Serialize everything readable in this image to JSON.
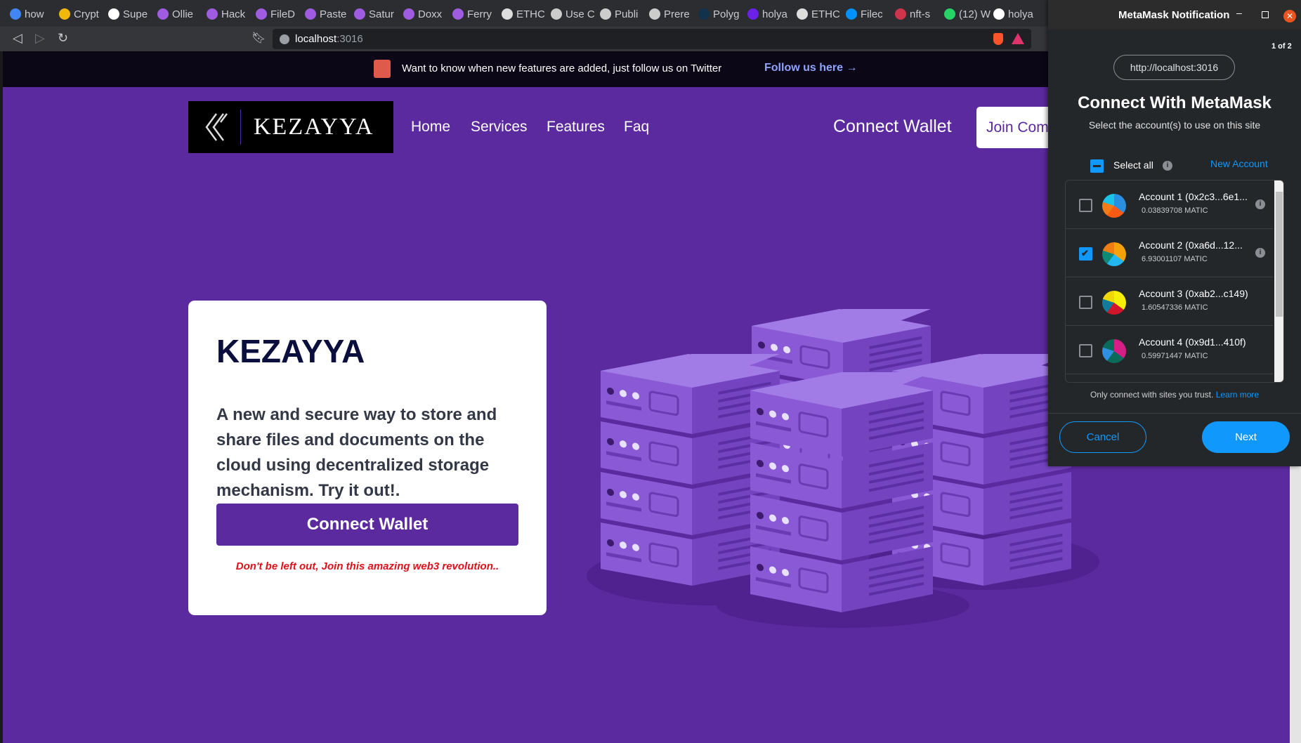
{
  "browser": {
    "tabs": [
      {
        "label": "how",
        "icon": "google-icon",
        "color": "#4285f4"
      },
      {
        "label": "Crypt",
        "icon": "binance-icon",
        "color": "#f0b90b"
      },
      {
        "label": "Supe",
        "icon": "github-icon",
        "color": "#ffffff"
      },
      {
        "label": "Ollie",
        "icon": "graphql-icon",
        "color": "#a05ce0"
      },
      {
        "label": "Hack",
        "icon": "graphql-icon",
        "color": "#a05ce0"
      },
      {
        "label": "FileD",
        "icon": "graphql-icon",
        "color": "#a05ce0"
      },
      {
        "label": "Paste",
        "icon": "graphql-icon",
        "color": "#a05ce0"
      },
      {
        "label": "Satur",
        "icon": "graphql-icon",
        "color": "#a05ce0"
      },
      {
        "label": "Doxx",
        "icon": "graphql-icon",
        "color": "#a05ce0"
      },
      {
        "label": "Ferry",
        "icon": "graphql-icon",
        "color": "#a05ce0"
      },
      {
        "label": "ETHC",
        "icon": "ethc-icon",
        "color": "#dddddd"
      },
      {
        "label": "Use C",
        "icon": "cloud-icon",
        "color": "#cccccc"
      },
      {
        "label": "Publi",
        "icon": "cloud-icon",
        "color": "#cccccc"
      },
      {
        "label": "Prere",
        "icon": "cloud-icon",
        "color": "#cccccc"
      },
      {
        "label": "Polyg",
        "icon": "d-icon",
        "color": "#12314a"
      },
      {
        "label": "holya",
        "icon": "purple-icon",
        "color": "#6b21e8"
      },
      {
        "label": "ETHC",
        "icon": "ethc-icon",
        "color": "#dddddd"
      },
      {
        "label": "Filec",
        "icon": "filecoin-icon",
        "color": "#0090ff"
      },
      {
        "label": "nft-s",
        "icon": "badge-72-icon",
        "color": "#d0344a"
      },
      {
        "label": "(12) W",
        "icon": "whatsapp-icon",
        "color": "#25d366"
      },
      {
        "label": "holya",
        "icon": "github-icon",
        "color": "#ffffff"
      }
    ],
    "url_host": "localhost",
    "url_port": ":3016"
  },
  "banner": {
    "text": "Want to know when new features are added, just follow us on Twitter",
    "link": "Follow us here →"
  },
  "nav": {
    "logo_text": "KEZAYYA",
    "links": [
      "Home",
      "Services",
      "Features",
      "Faq"
    ],
    "connect": "Connect Wallet",
    "join": "Join Com"
  },
  "hero": {
    "title": "KEZAYYA",
    "description": "A new and secure way to store and share files and documents on the cloud using decentralized storage mechanism. Try it out!.",
    "button": "Connect Wallet",
    "tagline": "Don't be left out, Join this amazing web3 revolution.."
  },
  "metamask": {
    "window_title": "MetaMask Notification",
    "page": "1 of 2",
    "origin": "http://localhost:3016",
    "title": "Connect With MetaMask",
    "subtitle": "Select the account(s) to use on this site",
    "select_all": "Select all",
    "new_account": "New Account",
    "accounts": [
      {
        "name": "Account 1 (0x2c3...6e1...",
        "balance": "0.03839708 MATIC",
        "checked": false,
        "colors": [
          "#2a8fe0",
          "#ff5a13",
          "#f37b16",
          "#19c4e8"
        ]
      },
      {
        "name": "Account 2 (0xa6d...12...",
        "balance": "6.93001107 MATIC",
        "checked": true,
        "colors": [
          "#f5a20a",
          "#22b7f0",
          "#0d8a78",
          "#f07d12"
        ]
      },
      {
        "name": "Account 3 (0xab2...c149)",
        "balance": "1.60547336 MATIC",
        "checked": false,
        "colors": [
          "#f5f006",
          "#d0162a",
          "#127a9a",
          "#f0d806"
        ]
      },
      {
        "name": "Account 4 (0x9d1...410f)",
        "balance": "0.59971447 MATIC",
        "checked": false,
        "colors": [
          "#d31f86",
          "#0b6b5a",
          "#2f8fe0",
          "#0b6b5a"
        ]
      }
    ],
    "trust_text": "Only connect with sites you trust.",
    "learn_more": "Learn more",
    "cancel": "Cancel",
    "next": "Next",
    "accent": "#1098fc"
  }
}
